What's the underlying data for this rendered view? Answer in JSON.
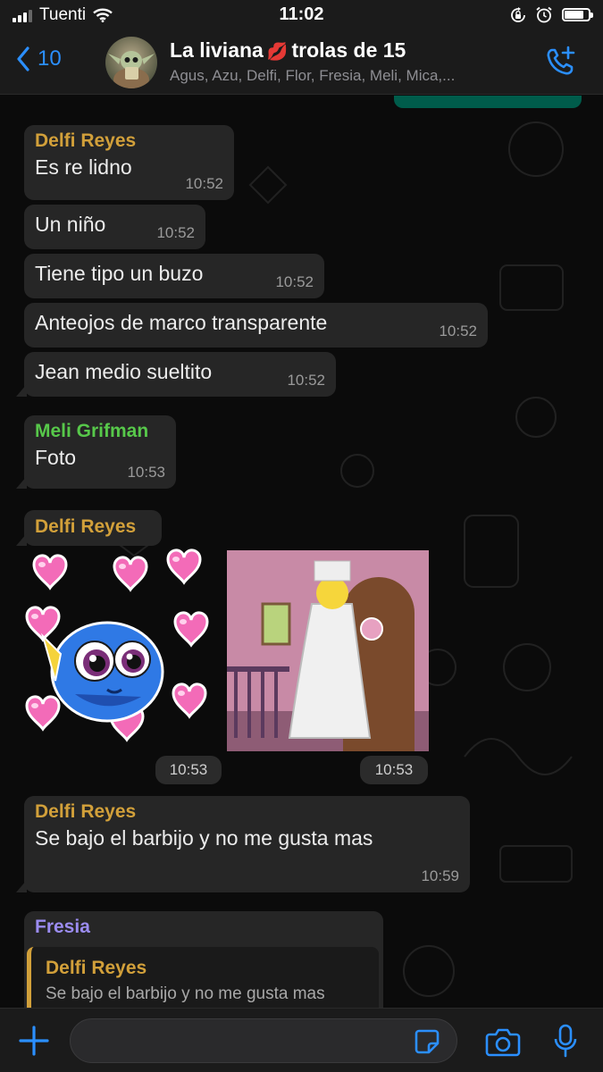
{
  "status": {
    "carrier": "Tuenti",
    "time": "11:02"
  },
  "header": {
    "back_count": "10",
    "title": "La liviana",
    "title_emoji": "💋",
    "title_suffix": "trolas de 15",
    "subtitle": "Agus, Azu, Delfi, Flor, Fresia, Meli, Mica,..."
  },
  "messages": [
    {
      "sender": "Delfi Reyes",
      "text": "Es re lidno",
      "time": "10:52"
    },
    {
      "text": "Un niño",
      "time": "10:52"
    },
    {
      "text": "Tiene tipo un buzo",
      "time": "10:52"
    },
    {
      "text": "Anteojos de marco transparente",
      "time": "10:52"
    },
    {
      "text": "Jean medio sueltito",
      "time": "10:52"
    },
    {
      "sender": "Meli Grifman",
      "text": "Foto",
      "time": "10:53"
    },
    {
      "sender": "Delfi Reyes"
    },
    {
      "text": "Se bajo el barbijo y no me gusta mas",
      "sender": "Delfi Reyes",
      "time": "10:59"
    },
    {
      "sender": "Fresia",
      "quote_sender": "Delfi Reyes",
      "quote_text": "Se bajo el barbijo y no me gusta mas"
    }
  ],
  "media": {
    "sticker_time": "10:53",
    "gif_time": "10:53"
  },
  "colors": {
    "delfi": "#d2a03a",
    "meli": "#57c84a",
    "fresia": "#9b8cf0",
    "accent": "#2b8fff",
    "outgoing": "#005c4b"
  },
  "composer": {
    "placeholder": ""
  }
}
